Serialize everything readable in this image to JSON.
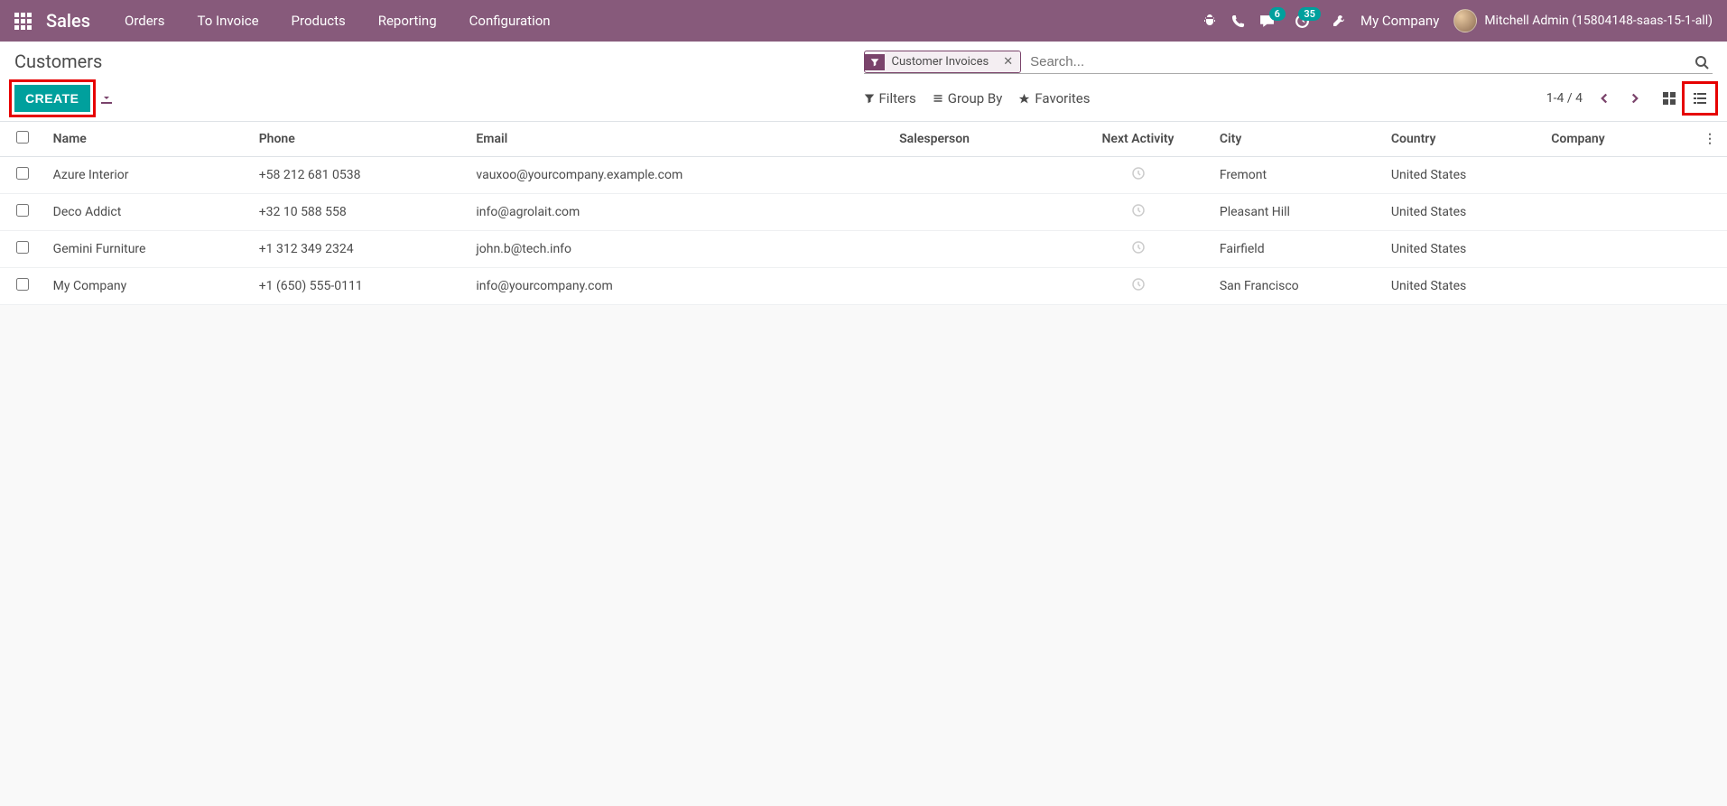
{
  "navbar": {
    "brand": "Sales",
    "menu": [
      "Orders",
      "To Invoice",
      "Products",
      "Reporting",
      "Configuration"
    ],
    "messaging_badge": "6",
    "activities_badge": "35",
    "company": "My Company",
    "user": "Mitchell Admin (15804148-saas-15-1-all)"
  },
  "breadcrumb": {
    "title": "Customers"
  },
  "buttons": {
    "create": "CREATE"
  },
  "search": {
    "tag_label": "Customer Invoices",
    "placeholder": "Search..."
  },
  "search_options": {
    "filters": "Filters",
    "group_by": "Group By",
    "favorites": "Favorites"
  },
  "pager": {
    "text": "1-4 / 4"
  },
  "columns": {
    "name": "Name",
    "phone": "Phone",
    "email": "Email",
    "salesperson": "Salesperson",
    "next_activity": "Next Activity",
    "city": "City",
    "country": "Country",
    "company": "Company"
  },
  "rows": [
    {
      "name": "Azure Interior",
      "phone": "+58 212 681 0538",
      "email": "vauxoo@yourcompany.example.com",
      "salesperson": "",
      "city": "Fremont",
      "country": "United States",
      "company": ""
    },
    {
      "name": "Deco Addict",
      "phone": "+32 10 588 558",
      "email": "info@agrolait.com",
      "salesperson": "",
      "city": "Pleasant Hill",
      "country": "United States",
      "company": ""
    },
    {
      "name": "Gemini Furniture",
      "phone": "+1 312 349 2324",
      "email": "john.b@tech.info",
      "salesperson": "",
      "city": "Fairfield",
      "country": "United States",
      "company": ""
    },
    {
      "name": "My Company",
      "phone": "+1 (650) 555-0111",
      "email": "info@yourcompany.com",
      "salesperson": "",
      "city": "San Francisco",
      "country": "United States",
      "company": ""
    }
  ]
}
